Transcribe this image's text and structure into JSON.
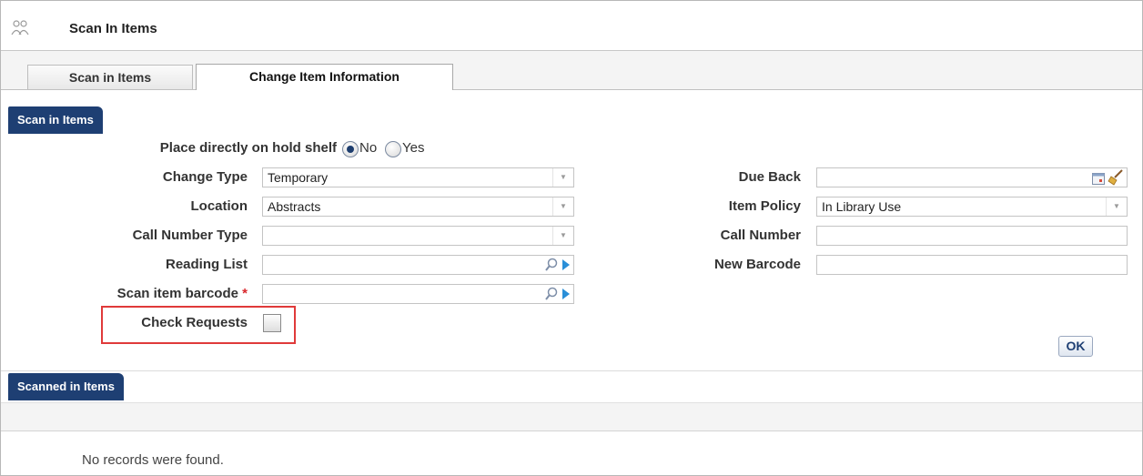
{
  "page": {
    "title": "Scan In Items",
    "icon": "users-group-icon"
  },
  "tabs": [
    {
      "label": "Scan in Items",
      "active": false
    },
    {
      "label": "Change Item Information",
      "active": true
    }
  ],
  "scan_section": {
    "header": "Scan in Items",
    "hold_shelf": {
      "label": "Place directly on hold shelf",
      "options": [
        "No",
        "Yes"
      ],
      "selected": "No"
    },
    "change_type": {
      "label": "Change Type",
      "value": "Temporary"
    },
    "location": {
      "label": "Location",
      "value": "Abstracts"
    },
    "call_number_type": {
      "label": "Call Number Type",
      "value": ""
    },
    "reading_list": {
      "label": "Reading List",
      "value": ""
    },
    "scan_item_barcode": {
      "label": "Scan item barcode",
      "required_mark": "*",
      "value": ""
    },
    "check_requests": {
      "label": "Check Requests",
      "checked": false
    },
    "due_back": {
      "label": "Due Back",
      "value": ""
    },
    "item_policy": {
      "label": "Item Policy",
      "value": "In Library Use"
    },
    "call_number": {
      "label": "Call Number",
      "value": ""
    },
    "new_barcode": {
      "label": "New Barcode",
      "value": ""
    },
    "ok_label": "OK"
  },
  "scanned_section": {
    "header": "Scanned in Items",
    "empty_message": "No records were found."
  },
  "colors": {
    "section_bar": "#1e3f73",
    "required": "#d8262b",
    "highlight": "#e03a3a"
  }
}
